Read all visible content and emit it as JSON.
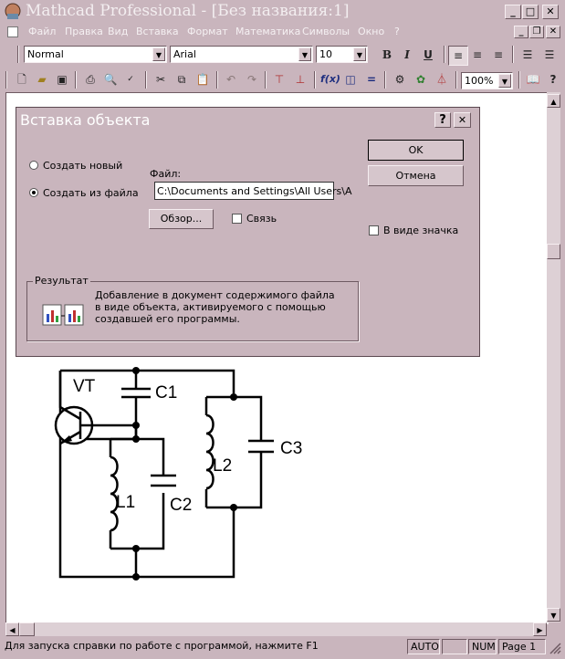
{
  "window": {
    "title": "Mathcad Professional - [Без названия:1]"
  },
  "menu": [
    "Файл",
    "Правка",
    "Вид",
    "Вставка",
    "Формат",
    "Математика",
    "Символы",
    "Окно",
    "?"
  ],
  "format_toolbar": {
    "style": "Normal",
    "font": "Arial",
    "size": "10",
    "bold": "B",
    "italic": "I",
    "underline": "U"
  },
  "standard_toolbar": {
    "zoom": "100%"
  },
  "dialog": {
    "title": "Вставка объекта",
    "help": "?",
    "close": "✕",
    "create_new": "Создать новый",
    "create_from_file": "Создать из файла",
    "file_label": "Файл:",
    "file_path": "C:\\Documents and Settings\\All Users\\A",
    "browse": "Обзор...",
    "link": "Связь",
    "ok": "OK",
    "cancel": "Отмена",
    "as_icon": "В виде значка",
    "result_label": "Результат",
    "result_text": [
      "Добавление в документ содержимого файла",
      "в виде объекта, активируемого с помощью",
      "создавшей его программы."
    ]
  },
  "circuit": {
    "labels": {
      "vt": "VT",
      "c1": "C1",
      "c2": "C2",
      "c3": "C3",
      "l1": "L1",
      "l2": "L2"
    }
  },
  "status": {
    "help": "Для запуска справки по работе с программой, нажмите F1",
    "auto": "AUTO",
    "num": "NUM",
    "page": "Page 1"
  }
}
